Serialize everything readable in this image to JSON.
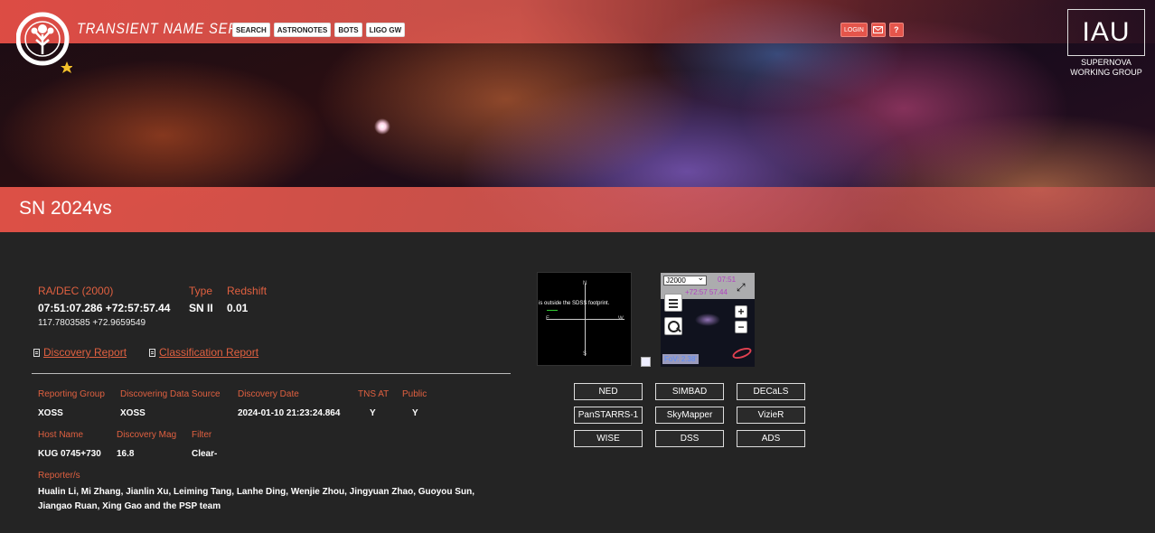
{
  "header": {
    "site_title": "TRANSIENT NAME SERVER",
    "nav": [
      "SEARCH",
      "ASTRONOTES",
      "BOTS",
      "LIGO GW"
    ],
    "login_label": "LOGIN",
    "help_label": "?",
    "iau_text": "IAU",
    "iau_subtitle_line1": "SUPERNOVA",
    "iau_subtitle_line2": "WORKING GROUP",
    "icons": [
      "tns-logo-icon",
      "mail-icon"
    ],
    "accent_color": "#e4554b"
  },
  "object": {
    "name": "SN 2024vs",
    "radec_label": "RA/DEC (2000)",
    "radec_value": "07:51:07.286 +72:57:57.44",
    "radec_degrees": "117.7803585 +72.9659549",
    "type_label": "Type",
    "type_value": "SN II",
    "redshift_label": "Redshift",
    "redshift_value": "0.01"
  },
  "reports": {
    "discovery": "Discovery Report",
    "classification": "Classification Report"
  },
  "details": {
    "reporting_group_label": "Reporting Group",
    "reporting_group": "XOSS",
    "data_source_label": "Discovering Data Source",
    "data_source": "XOSS",
    "discovery_date_label": "Discovery Date",
    "discovery_date": "2024-01-10 21:23:24.864",
    "tns_at_label": "TNS AT",
    "tns_at": "Y",
    "public_label": "Public",
    "public": "Y",
    "host_name_label": "Host Name",
    "host_name": "KUG 0745+730",
    "discovery_mag_label": "Discovery Mag",
    "discovery_mag": "16.8",
    "filter_label": "Filter",
    "filter": "Clear-",
    "reporters_label": "Reporter/s",
    "reporters": "Hualin Li, Mi Zhang, Jianlin Xu, Leiming Tang, Lanhe Ding, Wenjie Zhou, Jingyuan Zhao, Guoyou Sun, Jiangao Ruan, Xing Gao and the PSP team"
  },
  "sdss_thumb": {
    "message": "is outside the SDSS footprint.",
    "north": "N",
    "south": "S",
    "east": "E",
    "west": "W"
  },
  "aladin": {
    "frame": "J2000",
    "ra": "07:51",
    "dec": "+72:57 57.44",
    "zoom_in": "+",
    "zoom_out": "−",
    "fov": "FoV: 2.38'"
  },
  "external_links": [
    "NED",
    "SIMBAD",
    "DECaLS",
    "PanSTARRS-1",
    "SkyMapper",
    "VizieR",
    "WISE",
    "DSS",
    "ADS"
  ]
}
